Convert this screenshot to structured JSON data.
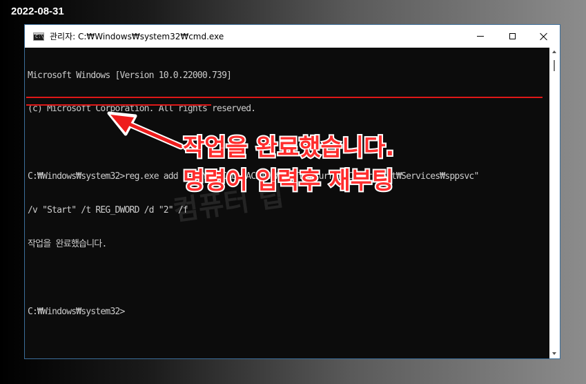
{
  "date_stamp": "2022-08-31",
  "window": {
    "title": "관리자: C:₩Windows₩system32₩cmd.exe",
    "icon": "cmd-icon",
    "buttons": {
      "minimize": "minimize-icon",
      "maximize": "maximize-icon",
      "close": "close-icon"
    }
  },
  "console": {
    "lines": [
      "Microsoft Windows [Version 10.0.22000.739]",
      "(c) Microsoft Corporation. All rights reserved.",
      "",
      "C:₩Windows₩system32>reg.exe add \"HKEY_LOCAL_MACHINE₩SYSTEM₩CurrentControlSet₩Services₩sppsvc\"",
      "/v \"Start\" /t REG_DWORD /d \"2\" /f",
      "작업을 완료했습니다.",
      "",
      "C:₩Windows₩system32>"
    ]
  },
  "annotation": {
    "line1": "작업을 완료했습니다.",
    "line2": "명령어 입력후 재부팅"
  },
  "watermark": "컴퓨터 팁",
  "colors": {
    "console_bg": "#0c0c0c",
    "console_text": "#cccccc",
    "annotation_red": "#ff2d2d",
    "underline_red": "#e01818"
  }
}
